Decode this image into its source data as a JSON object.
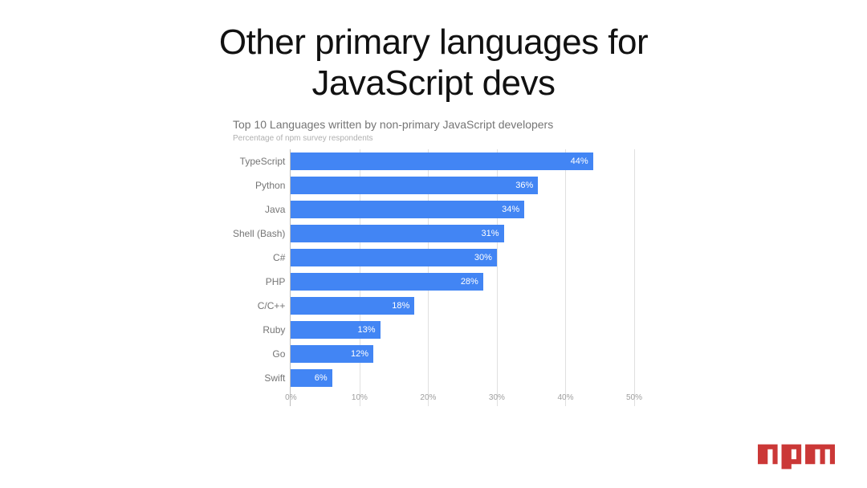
{
  "slide": {
    "title_line1": "Other primary languages for",
    "title_line2": "JavaScript devs"
  },
  "logo": {
    "name": "npm",
    "color": "#cb3837"
  },
  "chart_data": {
    "type": "bar",
    "orientation": "horizontal",
    "title": "Top 10 Languages written by non-primary JavaScript developers",
    "subtitle": "Percentage of npm survey respondents",
    "xlabel": "",
    "ylabel": "",
    "xlim": [
      0,
      50
    ],
    "xticks": [
      "0%",
      "10%",
      "20%",
      "30%",
      "40%",
      "50%"
    ],
    "categories": [
      "TypeScript",
      "Python",
      "Java",
      "Shell (Bash)",
      "C#",
      "PHP",
      "C/C++",
      "Ruby",
      "Go",
      "Swift"
    ],
    "values": [
      44,
      36,
      34,
      31,
      30,
      28,
      18,
      13,
      12,
      6
    ],
    "value_labels": [
      "44%",
      "36%",
      "34%",
      "31%",
      "30%",
      "28%",
      "18%",
      "13%",
      "12%",
      "6%"
    ],
    "bar_color": "#4285f4"
  }
}
